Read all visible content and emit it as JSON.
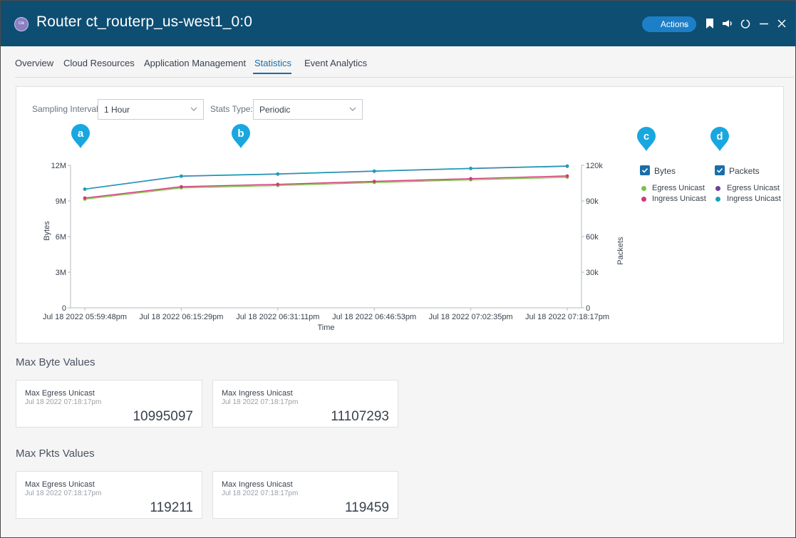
{
  "window": {
    "app_logo_text": "Cilk",
    "title": "Router ct_routerp_us-west1_0:0",
    "actions_label": "Actions"
  },
  "tabs": [
    {
      "label": "Overview",
      "active": false
    },
    {
      "label": "Cloud Resources",
      "active": false
    },
    {
      "label": "Application Management",
      "active": false
    },
    {
      "label": "Statistics",
      "active": true
    },
    {
      "label": "Event Analytics",
      "active": false
    }
  ],
  "controls": {
    "sampling_interval_label": "Sampling Interval:",
    "sampling_interval_value": "1 Hour",
    "stats_type_label": "Stats Type:",
    "stats_type_value": "Periodic"
  },
  "callouts": [
    "a",
    "b",
    "c",
    "d"
  ],
  "legend": {
    "bytes": {
      "label": "Bytes",
      "checked": true,
      "items": [
        {
          "label": "Egress Unicast",
          "color": "#7ac143"
        },
        {
          "label": "Ingress Unicast",
          "color": "#d6337c"
        }
      ]
    },
    "packets": {
      "label": "Packets",
      "checked": true,
      "items": [
        {
          "label": "Egress Unicast",
          "color": "#6c3fa0"
        },
        {
          "label": "Ingress Unicast",
          "color": "#17a2b8"
        }
      ]
    }
  },
  "chart_data": {
    "type": "line",
    "x": [
      "Jul 18 2022 05:59:48pm",
      "Jul 18 2022 06:15:29pm",
      "Jul 18 2022 06:31:11pm",
      "Jul 18 2022 06:46:53pm",
      "Jul 18 2022 07:02:35pm",
      "Jul 18 2022 07:18:17pm"
    ],
    "xlabel": "Time",
    "ylabel_left": "Bytes",
    "ylabel_right": "Packets",
    "y_left_ticks": [
      "0",
      "3M",
      "6M",
      "9M",
      "12M"
    ],
    "y_right_ticks": [
      "0",
      "30k",
      "60k",
      "90k",
      "120k"
    ],
    "ylim_left": [
      0,
      12000000
    ],
    "ylim_right": [
      0,
      120000
    ],
    "series": [
      {
        "name": "Egress Unicast",
        "axis": "bytes",
        "color": "#7ac143",
        "values": [
          9150000,
          10100000,
          10300000,
          10550000,
          10780000,
          10995097
        ]
      },
      {
        "name": "Ingress Unicast",
        "axis": "bytes",
        "color": "#d6337c",
        "values": [
          9250000,
          10200000,
          10400000,
          10650000,
          10880000,
          11107293
        ]
      },
      {
        "name": "Egress Unicast",
        "axis": "packets",
        "color": "#6c3fa0",
        "values": [
          99900,
          110800,
          112600,
          115000,
          117300,
          119211
        ]
      },
      {
        "name": "Ingress Unicast",
        "axis": "packets",
        "color": "#17a2b8",
        "values": [
          100000,
          111000,
          112800,
          115200,
          117500,
          119459
        ]
      }
    ]
  },
  "max_bytes": {
    "title": "Max Byte Values",
    "cards": [
      {
        "title": "Max Egress Unicast",
        "date": "Jul 18 2022 07:18:17pm",
        "value": "10995097"
      },
      {
        "title": "Max Ingress Unicast",
        "date": "Jul 18 2022 07:18:17pm",
        "value": "11107293"
      }
    ]
  },
  "max_pkts": {
    "title": "Max Pkts Values",
    "cards": [
      {
        "title": "Max Egress Unicast",
        "date": "Jul 18 2022 07:18:17pm",
        "value": "119211"
      },
      {
        "title": "Max Ingress Unicast",
        "date": "Jul 18 2022 07:18:17pm",
        "value": "119459"
      }
    ]
  },
  "colors": {
    "titlebar": "#0e4e73",
    "accent": "#1a6ea8",
    "callout": "#19a7e0"
  }
}
